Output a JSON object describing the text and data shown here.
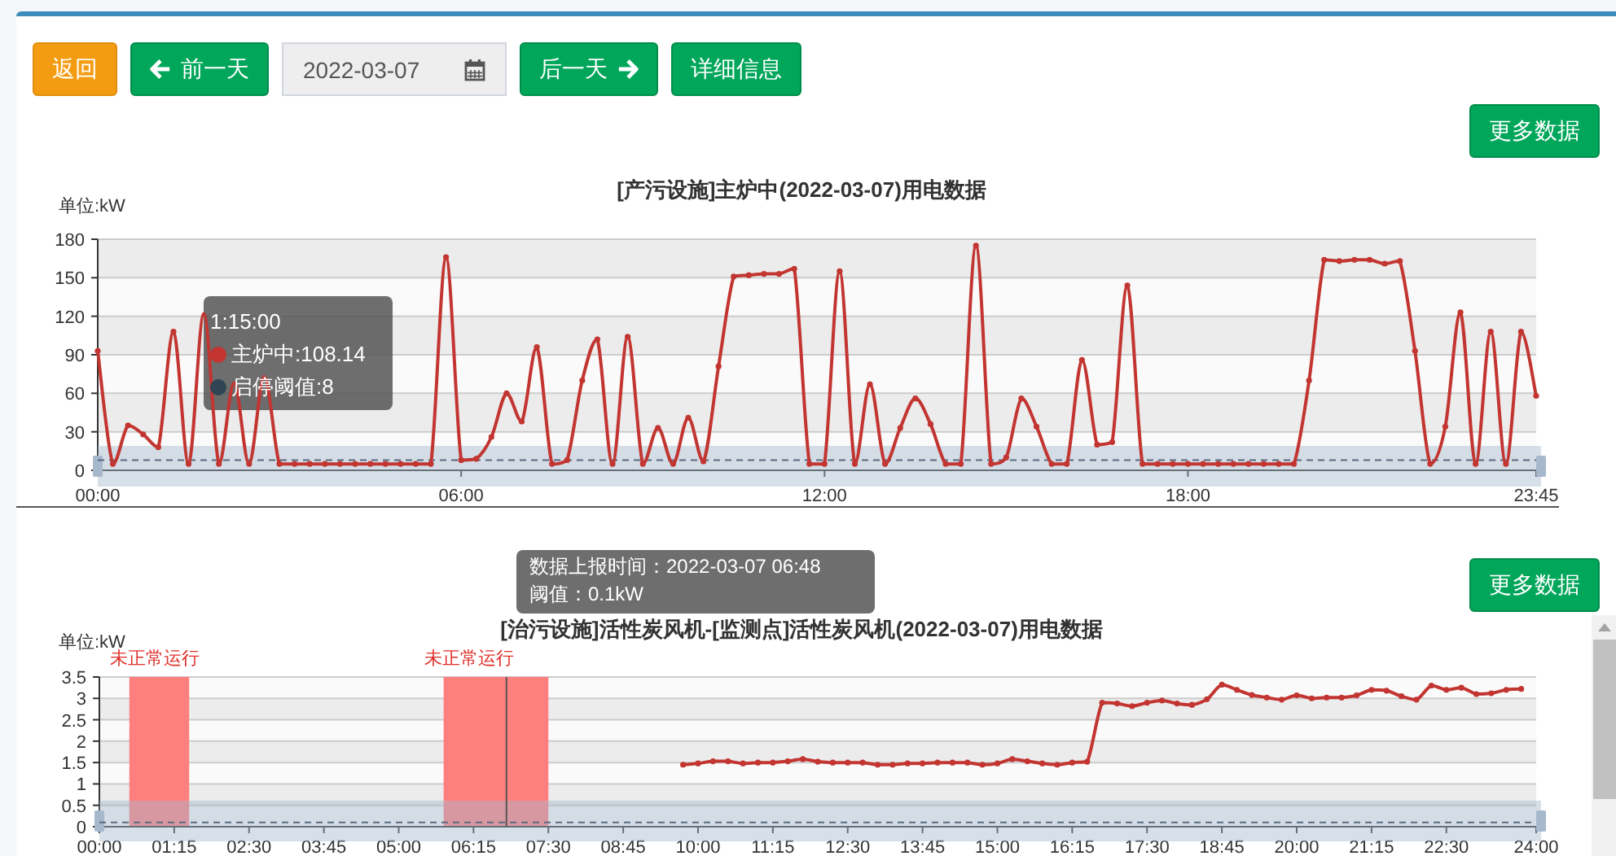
{
  "toolbar": {
    "back_button": "返回",
    "prev_button": "前一天",
    "date_field": {
      "value": "2022-03-07"
    },
    "next_button": "后一天",
    "detail_button": "详细信息"
  },
  "panels": [
    {
      "more_button": "更多数据",
      "tooltip": {
        "title": "1:15:00",
        "items": [
          {
            "text": "主炉中:108.14",
            "color": "#c23531"
          },
          {
            "text": "启停阈值:8",
            "color": "#2f4554"
          }
        ]
      },
      "chart_data": {
        "type": "line",
        "title": "[产污设施]主炉中(2022-03-07)用电数据",
        "ylabel": "单位:kW",
        "grid": true,
        "x": [
          0,
          0.25,
          0.5,
          0.75,
          1,
          1.25,
          1.5,
          1.75,
          2,
          2.25,
          2.5,
          2.75,
          3,
          3.25,
          3.5,
          3.75,
          4,
          4.25,
          4.5,
          4.75,
          5,
          5.25,
          5.5,
          5.75,
          6,
          6.25,
          6.5,
          6.75,
          7,
          7.25,
          7.5,
          7.75,
          8,
          8.25,
          8.5,
          8.75,
          9,
          9.25,
          9.5,
          9.75,
          10,
          10.25,
          10.5,
          10.75,
          11,
          11.25,
          11.5,
          11.75,
          12,
          12.25,
          12.5,
          12.75,
          13,
          13.25,
          13.5,
          13.75,
          14,
          14.25,
          14.5,
          14.75,
          15,
          15.25,
          15.5,
          15.75,
          16,
          16.25,
          16.5,
          16.75,
          17,
          17.25,
          17.5,
          17.75,
          18,
          18.25,
          18.5,
          18.75,
          19,
          19.25,
          19.5,
          19.75,
          20,
          20.25,
          20.5,
          20.75,
          21,
          21.25,
          21.5,
          21.75,
          22,
          22.25,
          22.5,
          22.75,
          23,
          23.25,
          23.5,
          23.75
        ],
        "series": [
          {
            "color": "#c23531",
            "marker": true,
            "values": [
              93,
              5,
              35,
              28,
              18,
              108,
              5,
              122,
              5,
              68,
              5,
              73,
              5,
              5,
              5,
              5,
              5,
              5,
              5,
              5,
              5,
              5,
              5,
              166,
              8,
              9,
              26,
              60,
              38,
              96,
              5,
              8,
              70,
              102,
              5,
              104,
              5,
              33,
              5,
              41,
              7,
              81,
              151,
              152,
              153,
              153,
              157,
              5,
              5,
              155,
              5,
              67,
              5,
              33,
              56,
              36,
              5,
              5,
              175,
              5,
              10,
              56,
              34,
              5,
              5,
              86,
              20,
              22,
              144,
              5,
              5,
              5,
              5,
              5,
              5,
              5,
              5,
              5,
              5,
              5,
              70,
              164,
              163,
              164,
              164,
              161,
              163,
              93,
              5,
              34,
              123,
              5,
              108,
              5,
              108,
              58
            ]
          }
        ],
        "xlim": [
          0,
          23.75
        ],
        "ylim": [
          0,
          180
        ],
        "yticks": [
          0,
          30,
          60,
          90,
          120,
          150,
          180
        ],
        "xticks": [
          {
            "value": 0,
            "label": "00:00"
          },
          {
            "value": 6,
            "label": "06:00"
          },
          {
            "value": 12,
            "label": "12:00"
          },
          {
            "value": 18,
            "label": "18:00"
          },
          {
            "value": 23.75,
            "label": "23:45"
          }
        ],
        "ref_lines": [
          {
            "axis": "y",
            "value": 8
          }
        ]
      }
    },
    {
      "more_button": "更多数据",
      "tooltip": {
        "lines": [
          "数据上报时间：2022-03-07 06:48",
          "阈值：0.1kW"
        ]
      },
      "chart_data": {
        "type": "line",
        "title": "[治污设施]活性炭风机-[监测点]活性炭风机(2022-03-07)用电数据",
        "ylabel": "单位:kW",
        "grid": true,
        "x": [
          9.75,
          10,
          10.25,
          10.5,
          10.75,
          11,
          11.25,
          11.5,
          11.75,
          12,
          12.25,
          12.5,
          12.75,
          13,
          13.25,
          13.5,
          13.75,
          14,
          14.25,
          14.5,
          14.75,
          15,
          15.25,
          15.5,
          15.75,
          16,
          16.25,
          16.5,
          16.75,
          17,
          17.25,
          17.5,
          17.75,
          18,
          18.25,
          18.5,
          18.75,
          19,
          19.25,
          19.5,
          19.75,
          20,
          20.25,
          20.5,
          20.75,
          21,
          21.25,
          21.5,
          21.75,
          22,
          22.25,
          22.5,
          22.75,
          23,
          23.25,
          23.5,
          23.75
        ],
        "series": [
          {
            "color": "#c23531",
            "marker": true,
            "values": [
              1.45,
              1.48,
              1.53,
              1.53,
              1.48,
              1.5,
              1.5,
              1.53,
              1.58,
              1.52,
              1.5,
              1.5,
              1.5,
              1.45,
              1.45,
              1.48,
              1.48,
              1.5,
              1.5,
              1.5,
              1.45,
              1.48,
              1.58,
              1.53,
              1.48,
              1.45,
              1.5,
              1.52,
              2.9,
              2.88,
              2.82,
              2.9,
              2.95,
              2.88,
              2.85,
              2.98,
              3.32,
              3.2,
              3.08,
              3.02,
              2.97,
              3.07,
              3.0,
              3.02,
              3.02,
              3.07,
              3.2,
              3.18,
              3.05,
              2.97,
              3.3,
              3.2,
              3.25,
              3.1,
              3.12,
              3.2,
              3.22
            ]
          }
        ],
        "xlim": [
          0,
          24
        ],
        "ylim": [
          0,
          3.5
        ],
        "yticks": [
          0,
          0.5,
          1,
          1.5,
          2,
          2.5,
          3,
          3.5
        ],
        "xticks": [
          {
            "value": 0,
            "label": "00:00"
          },
          {
            "value": 1.25,
            "label": "01:15"
          },
          {
            "value": 2.5,
            "label": "02:30"
          },
          {
            "value": 3.75,
            "label": "03:45"
          },
          {
            "value": 5,
            "label": "05:00"
          },
          {
            "value": 6.25,
            "label": "06:15"
          },
          {
            "value": 7.5,
            "label": "07:30"
          },
          {
            "value": 8.75,
            "label": "08:45"
          },
          {
            "value": 10,
            "label": "10:00"
          },
          {
            "value": 11.25,
            "label": "11:15"
          },
          {
            "value": 12.5,
            "label": "12:30"
          },
          {
            "value": 13.75,
            "label": "13:45"
          },
          {
            "value": 15,
            "label": "15:00"
          },
          {
            "value": 16.25,
            "label": "16:15"
          },
          {
            "value": 17.5,
            "label": "17:30"
          },
          {
            "value": 18.75,
            "label": "18:45"
          },
          {
            "value": 20,
            "label": "20:00"
          },
          {
            "value": 21.25,
            "label": "21:15"
          },
          {
            "value": 22.5,
            "label": "22:30"
          },
          {
            "value": 24,
            "label": "24:00"
          }
        ],
        "ref_lines": [
          {
            "axis": "y",
            "value": 0.1
          },
          {
            "axis": "x",
            "value": 6.8
          }
        ],
        "bands": [
          {
            "axis": "x",
            "from": 0.5,
            "to": 1.5,
            "label": "未正常运行"
          },
          {
            "axis": "x",
            "from": 5.75,
            "to": 7.5,
            "label": "未正常运行"
          }
        ]
      }
    }
  ]
}
